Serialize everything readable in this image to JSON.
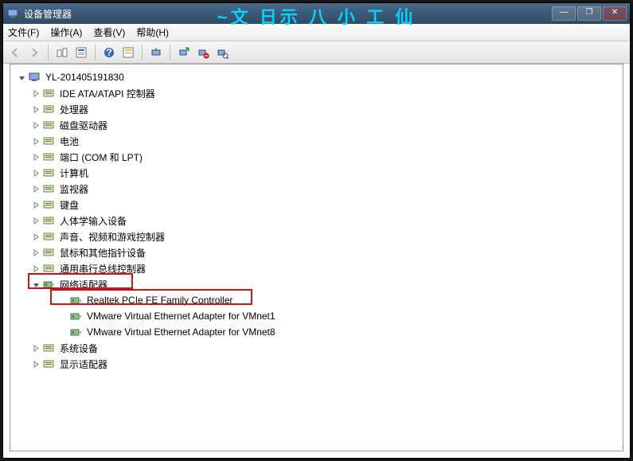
{
  "window": {
    "title": "设备管理器"
  },
  "overlay_text": "~文 日示    八 小 工 仙",
  "control_buttons": {
    "min": "—",
    "max": "❐",
    "close": "✕"
  },
  "menus": {
    "file": "文件(F)",
    "action": "操作(A)",
    "view": "查看(V)",
    "help": "帮助(H)"
  },
  "tree": {
    "root": "YL-201405191830",
    "items": [
      {
        "label": "IDE ATA/ATAPI 控制器"
      },
      {
        "label": "处理器"
      },
      {
        "label": "磁盘驱动器"
      },
      {
        "label": "电池"
      },
      {
        "label": "端口 (COM 和 LPT)"
      },
      {
        "label": "计算机"
      },
      {
        "label": "监视器"
      },
      {
        "label": "键盘"
      },
      {
        "label": "人体学输入设备"
      },
      {
        "label": "声音、视频和游戏控制器"
      },
      {
        "label": "鼠标和其他指针设备"
      },
      {
        "label": "通用串行总线控制器"
      },
      {
        "label": "网络适配器",
        "expanded": true,
        "children": [
          "Realtek PCIe FE Family Controller",
          "VMware Virtual Ethernet Adapter for VMnet1",
          "VMware Virtual Ethernet Adapter for VMnet8"
        ]
      },
      {
        "label": "系统设备"
      },
      {
        "label": "显示适配器"
      }
    ]
  }
}
